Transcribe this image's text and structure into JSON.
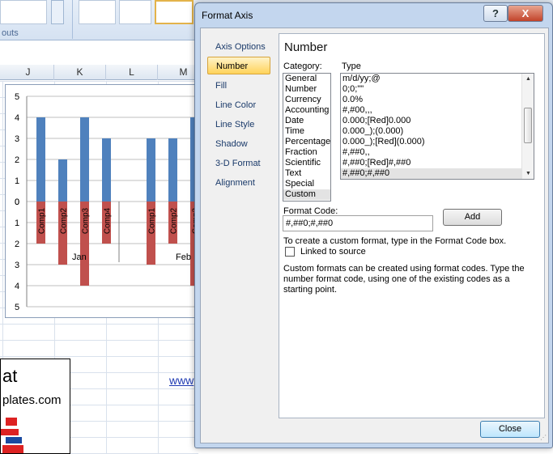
{
  "excel": {
    "ribbon_group_label": "outs",
    "columns": [
      "J",
      "K",
      "L",
      "M"
    ],
    "chart": {
      "y_ticks": [
        "5",
        "4",
        "3",
        "2",
        "1",
        "0",
        "0",
        "1",
        "2",
        "3",
        "4",
        "5"
      ],
      "bar_labels": [
        "Comp1",
        "Comp2",
        "Comp3",
        "Comp4",
        "Comp1",
        "Comp2",
        "Comp3"
      ],
      "groups": [
        "Jan",
        "Feb"
      ]
    },
    "template_title": "at",
    "template_sub": "plates.com",
    "link": "www"
  },
  "chart_data": {
    "type": "bar",
    "categories": [
      "Comp1",
      "Comp2",
      "Comp3",
      "Comp4",
      "Comp1",
      "Comp2",
      "Comp3"
    ],
    "groups": [
      "Jan",
      "Feb"
    ],
    "series": [
      {
        "color": "#4f81bd",
        "values": [
          4,
          2,
          4,
          3,
          3,
          3,
          4
        ]
      },
      {
        "color": "#c0504d",
        "values": [
          2,
          3,
          4,
          2,
          3,
          2,
          4
        ]
      }
    ],
    "ylim": [
      0,
      5
    ],
    "mirrored_axis": true,
    "grid": true
  },
  "dialog": {
    "title": "Format Axis",
    "help_label": "?",
    "close_x_label": "X",
    "nav": [
      "Axis Options",
      "Number",
      "Fill",
      "Line Color",
      "Line Style",
      "Shadow",
      "3-D Format",
      "Alignment"
    ],
    "section_title": "Number",
    "category_label": "Category:",
    "type_label": "Type",
    "categories": [
      "General",
      "Number",
      "Currency",
      "Accounting",
      "Date",
      "Time",
      "Percentage",
      "Fraction",
      "Scientific",
      "Text",
      "Special",
      "Custom"
    ],
    "selected_category": "Custom",
    "types": [
      "m/d/yy;@",
      "0;0;\"\"",
      "0.0%",
      "#,#00,,,",
      "0.000;[Red]0.000",
      "0.000_);(0.000)",
      "0.000_);[Red](0.000)",
      "#,##0,,",
      "#,##0;[Red]#,##0",
      "#,##0;#,##0"
    ],
    "selected_type": "#,##0;#,##0",
    "format_code_label": "Format Code:",
    "format_code_value": "#,##0;#,##0",
    "add_label": "Add",
    "hint_1": "To create a custom format, type in the Format Code box.",
    "linked_label": "Linked to source",
    "hint_2": "Custom formats can be created using format codes.  Type the number format code, using one of the existing codes as a starting point.",
    "close_label": "Close"
  }
}
